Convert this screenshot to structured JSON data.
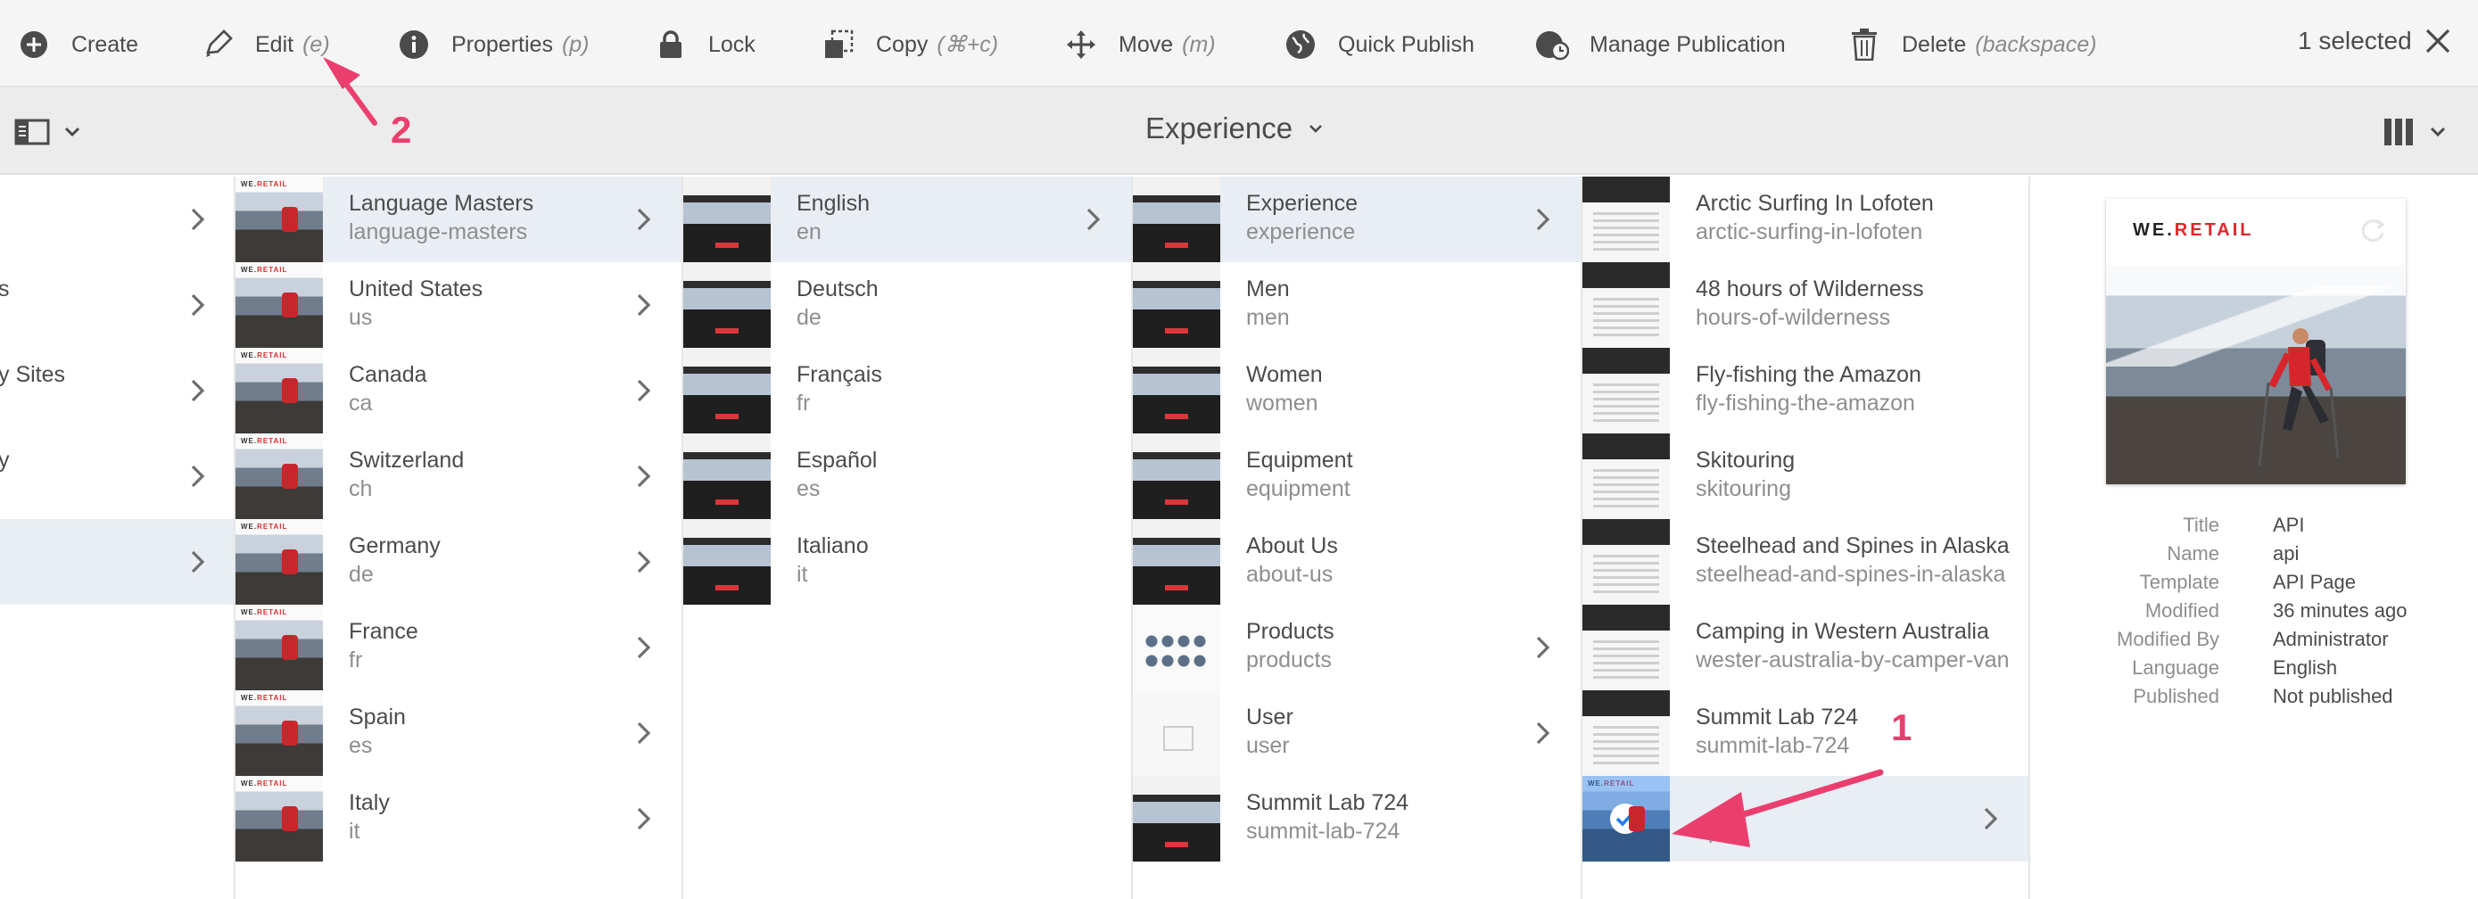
{
  "actionbar": {
    "create": "Create",
    "edit": "Edit",
    "edit_shortcut": "(e)",
    "properties": "Properties",
    "properties_shortcut": "(p)",
    "lock": "Lock",
    "copy": "Copy",
    "copy_shortcut": "(⌘+c)",
    "move": "Move",
    "move_shortcut": "(m)",
    "quick_publish": "Quick Publish",
    "manage_publication": "Manage Publication",
    "delete": "Delete",
    "delete_shortcut": "(backspace)",
    "selected_count": "1 selected"
  },
  "titlebar": {
    "title": "Experience"
  },
  "column0": {
    "items": [
      {
        "title": ""
      },
      {
        "title": "s"
      },
      {
        "title": "y Sites"
      },
      {
        "title": "y"
      },
      {
        "title": ""
      }
    ]
  },
  "column1": {
    "items": [
      {
        "title": "Language Masters",
        "name": "language-masters"
      },
      {
        "title": "United States",
        "name": "us"
      },
      {
        "title": "Canada",
        "name": "ca"
      },
      {
        "title": "Switzerland",
        "name": "ch"
      },
      {
        "title": "Germany",
        "name": "de"
      },
      {
        "title": "France",
        "name": "fr"
      },
      {
        "title": "Spain",
        "name": "es"
      },
      {
        "title": "Italy",
        "name": "it"
      }
    ]
  },
  "column2": {
    "items": [
      {
        "title": "English",
        "name": "en"
      },
      {
        "title": "Deutsch",
        "name": "de"
      },
      {
        "title": "Français",
        "name": "fr"
      },
      {
        "title": "Español",
        "name": "es"
      },
      {
        "title": "Italiano",
        "name": "it"
      }
    ]
  },
  "column3": {
    "items": [
      {
        "title": "Experience",
        "name": "experience"
      },
      {
        "title": "Men",
        "name": "men"
      },
      {
        "title": "Women",
        "name": "women"
      },
      {
        "title": "Equipment",
        "name": "equipment"
      },
      {
        "title": "About Us",
        "name": "about-us"
      },
      {
        "title": "Products",
        "name": "products"
      },
      {
        "title": "User",
        "name": "user"
      },
      {
        "title": "Summit Lab 724",
        "name": "summit-lab-724"
      }
    ]
  },
  "column4": {
    "items": [
      {
        "title": "Arctic Surfing In Lofoten",
        "name": "arctic-surfing-in-lofoten"
      },
      {
        "title": "48 hours of Wilderness",
        "name": "hours-of-wilderness"
      },
      {
        "title": "Fly-fishing the Amazon",
        "name": "fly-fishing-the-amazon"
      },
      {
        "title": "Skitouring",
        "name": "skitouring"
      },
      {
        "title": "Steelhead and Spines in Alaska",
        "name": "steelhead-and-spines-in-alaska"
      },
      {
        "title": "Camping in Western Australia",
        "name": "wester-australia-by-camper-van"
      },
      {
        "title": "Summit Lab 724",
        "name": "summit-lab-724"
      },
      {
        "title": "",
        "name": "ap"
      }
    ]
  },
  "preview": {
    "brand_we": "WE.",
    "brand_retail": "RETAIL",
    "meta": [
      {
        "key": "Title",
        "value": "API"
      },
      {
        "key": "Name",
        "value": "api"
      },
      {
        "key": "Template",
        "value": "API Page"
      },
      {
        "key": "Modified",
        "value": "36 minutes ago"
      },
      {
        "key": "Modified By",
        "value": "Administrator"
      },
      {
        "key": "Language",
        "value": "English"
      },
      {
        "key": "Published",
        "value": "Not published"
      }
    ]
  },
  "thumb_logo": {
    "we": "WE.",
    "retail": "RETAIL"
  },
  "annotations": {
    "one": "1",
    "two": "2"
  },
  "colors": {
    "accent": "#2680eb",
    "annotation": "#ea3f6e",
    "active_row": "#e9edf4",
    "brand_red": "#e0262b"
  }
}
